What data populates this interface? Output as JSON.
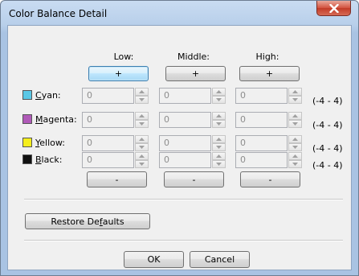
{
  "window": {
    "title": "Color Balance Detail",
    "close_icon": "close-icon"
  },
  "columns": {
    "low": "Low:",
    "middle": "Middle:",
    "high": "High:"
  },
  "plus_label": "+",
  "minus_label": "-",
  "rows": [
    {
      "label": "Cyan:",
      "mnemonic": "C",
      "label_rest": "yan:",
      "color": "#5bc8e6",
      "low": "0",
      "middle": "0",
      "high": "0",
      "range": "(-4 - 4)"
    },
    {
      "label": "Magenta:",
      "mnemonic": "M",
      "label_rest": "agenta:",
      "color": "#b05ab8",
      "low": "0",
      "middle": "0",
      "high": "0",
      "range": "(-4 - 4)"
    },
    {
      "label": "Yellow:",
      "mnemonic": "Y",
      "label_rest": "ellow:",
      "color": "#f5ee1c",
      "low": "0",
      "middle": "0",
      "high": "0",
      "range": "(-4 - 4)"
    },
    {
      "label": "Black:",
      "mnemonic": "B",
      "label_rest": "lack:",
      "color": "#111111",
      "low": "0",
      "middle": "0",
      "high": "0",
      "range": "(-4 - 4)"
    }
  ],
  "restore": {
    "pre": "Restore De",
    "mnemonic": "f",
    "post": "aults"
  },
  "ok_label": "OK",
  "cancel_label": "Cancel"
}
